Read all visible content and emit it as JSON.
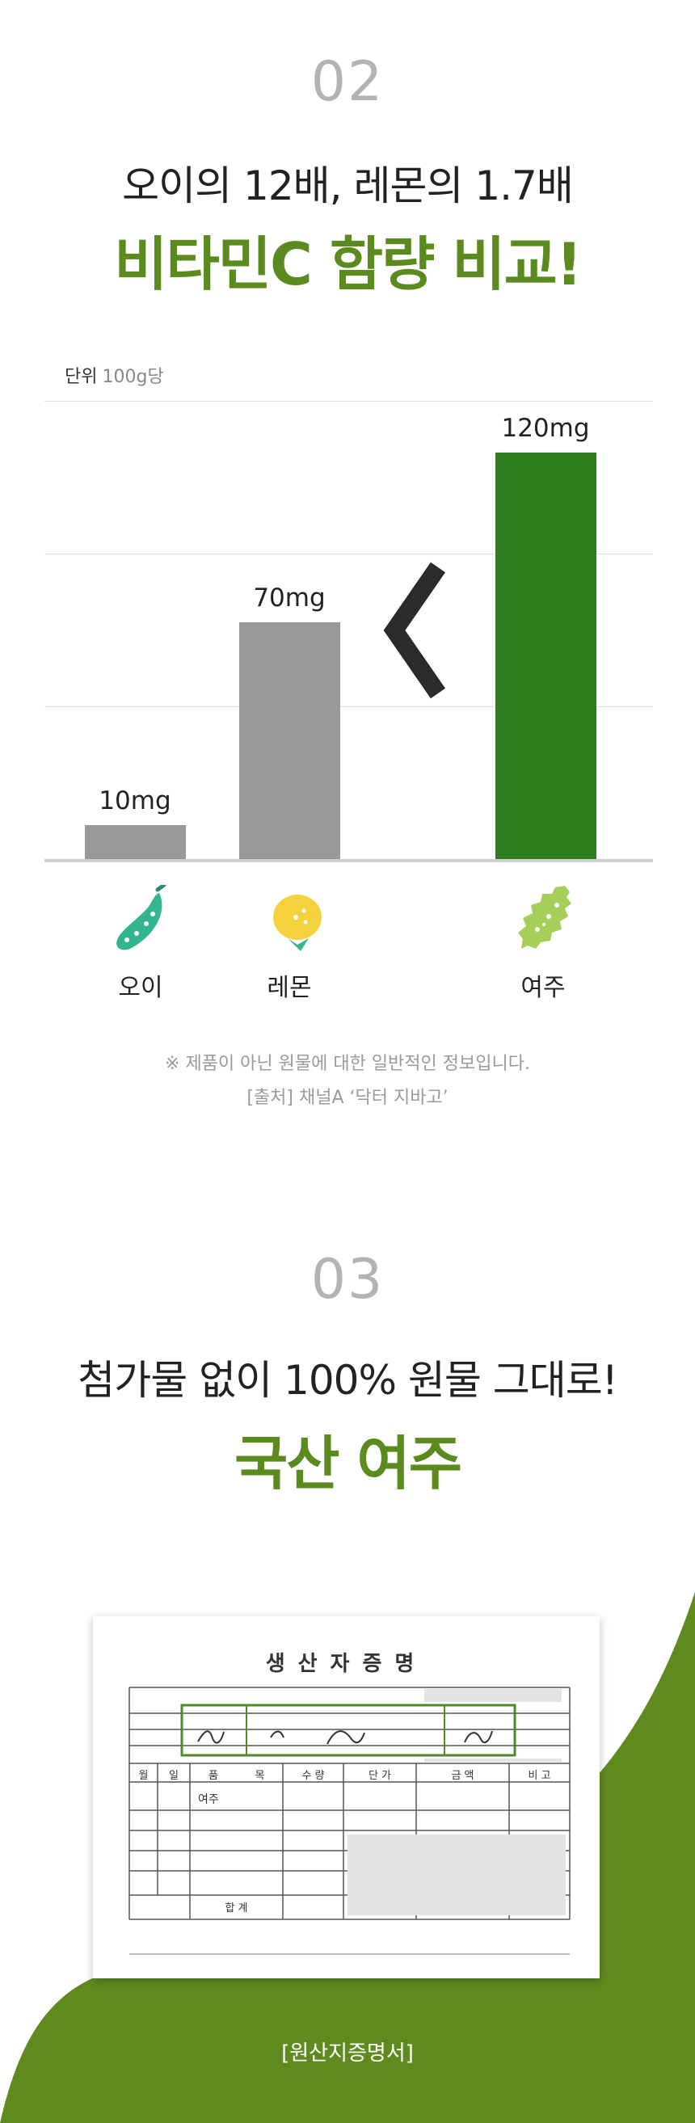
{
  "section2": {
    "number": "02",
    "subtitle": "오이의 12배, 레몬의 1.7배",
    "headline": "비타민C 함량 비교!",
    "unit_label": "단위",
    "unit_value": "100g당",
    "comparator": "<",
    "note": "※ 제품이 아닌 원물에 대한 일반적인 정보입니다.",
    "source": "[출처] 채널A ‘닥터 지바고’",
    "items": [
      {
        "name": "오이",
        "icon": "cucumber-icon"
      },
      {
        "name": "레몬",
        "icon": "lemon-icon"
      },
      {
        "name": "여주",
        "icon": "bitter-melon-icon"
      }
    ]
  },
  "chart_data": {
    "type": "bar",
    "categories": [
      "오이",
      "레몬",
      "여주"
    ],
    "values": [
      10,
      70,
      120
    ],
    "data_labels": [
      "10mg",
      "70mg",
      "120mg"
    ],
    "colors": [
      "#999999",
      "#999999",
      "#2e7d1e"
    ],
    "ylim": [
      0,
      120
    ],
    "grid": true,
    "unit": "100g당"
  },
  "section3": {
    "number": "03",
    "subtitle": "첨가물 없이 100% 원물 그대로!",
    "headline": "국산 여주",
    "document_title": "생산자증명",
    "document_columns": [
      "월",
      "일",
      "품",
      "목",
      "수 량",
      "단 가",
      "금 액",
      "비 고"
    ],
    "document_total_label": "합 계",
    "document_item": "여주",
    "caption": "[원산지증명서]"
  },
  "colors": {
    "accent_green": "#5b8a1f",
    "bar_green": "#2e7d1e",
    "bar_gray": "#999999",
    "number_gray": "#b3b3b3"
  }
}
